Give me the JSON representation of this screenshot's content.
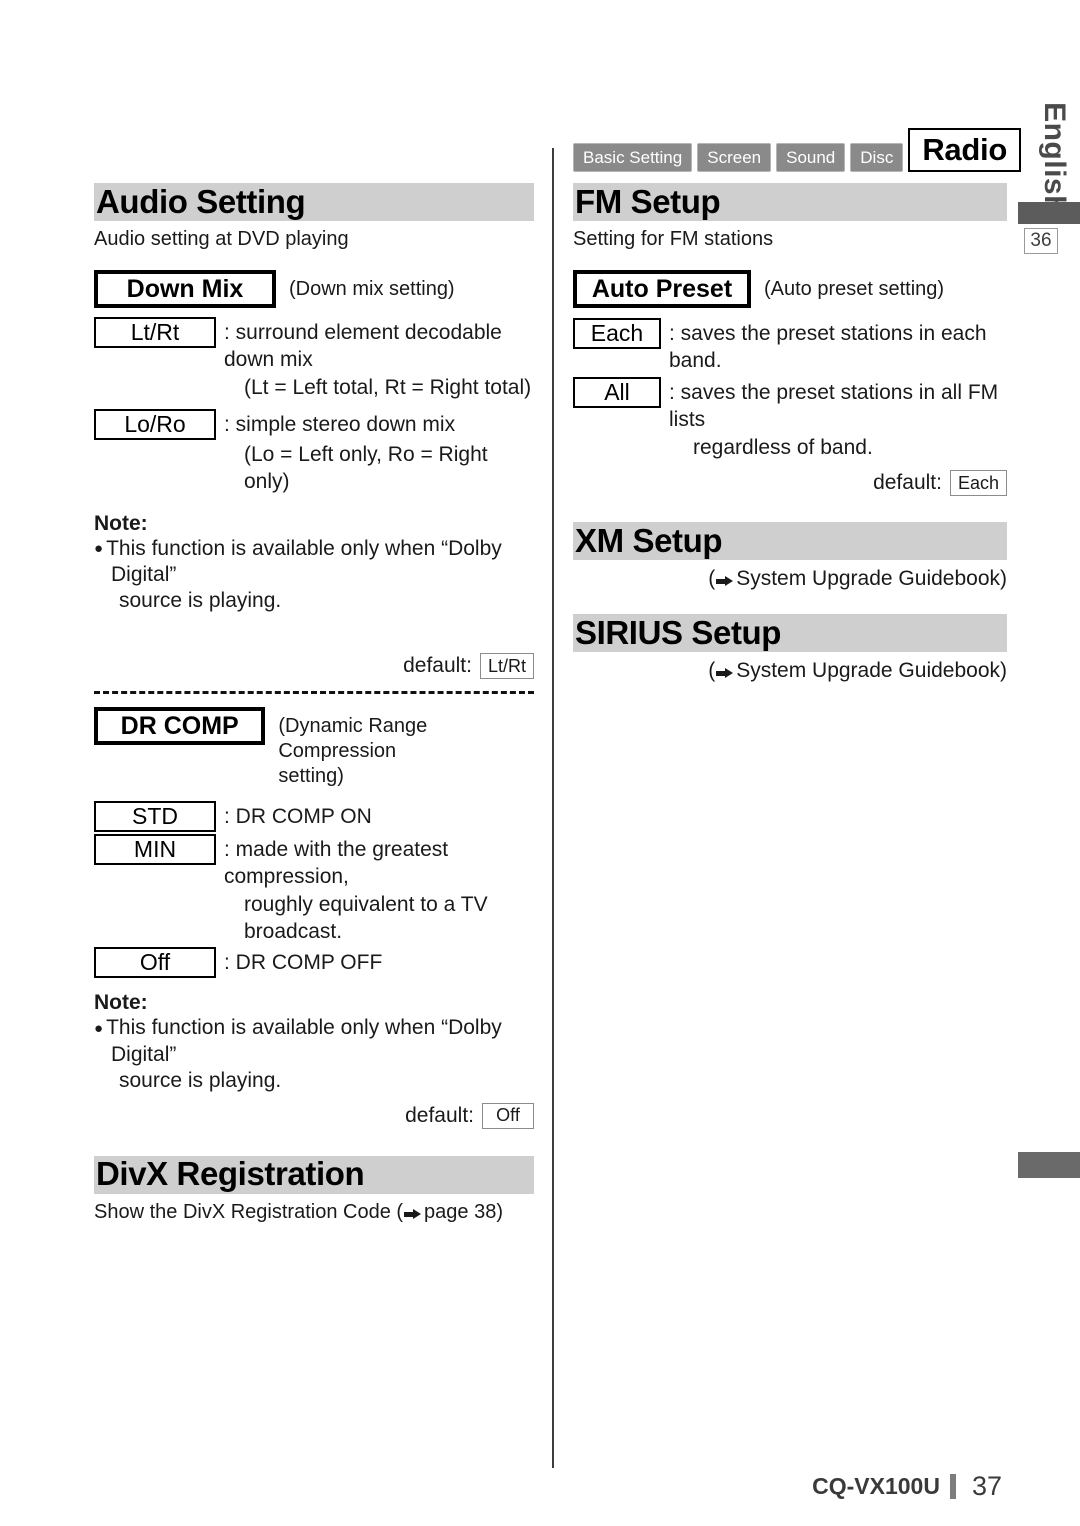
{
  "margin": {
    "language_label": "English",
    "chapter_ref": "36"
  },
  "footer": {
    "model": "CQ-VX100U",
    "page_number": "37"
  },
  "left_column": {
    "audio_setting": {
      "title": "Audio Setting",
      "subtitle": "Audio setting at DVD playing",
      "down_mix": {
        "name": "Down Mix",
        "note": "(Down mix setting)",
        "options": [
          {
            "value": "Lt/Rt",
            "desc": ": surround element decodable down mix",
            "sub": "(Lt = Left total, Rt = Right total)"
          },
          {
            "value": "Lo/Ro",
            "desc": ": simple stereo down mix",
            "sub": "(Lo = Left only, Ro = Right only)"
          }
        ],
        "note_title": "Note:",
        "note_body_1": "This function is available only when “Dolby Digital”",
        "note_body_2": "source is playing.",
        "default_label": "default:",
        "default_value": "Lt/Rt"
      },
      "dr_comp": {
        "name": "DR COMP",
        "note_line_1": "(Dynamic Range Compression",
        "note_line_2": "setting)",
        "options": [
          {
            "value": "STD",
            "desc": ": DR COMP ON",
            "sub": ""
          },
          {
            "value": "MIN",
            "desc": ": made with the greatest compression,",
            "sub": "roughly equivalent to a TV broadcast."
          },
          {
            "value": "Off",
            "desc": ": DR COMP OFF",
            "sub": ""
          }
        ],
        "note_title": "Note:",
        "note_body_1": "This function is available only when “Dolby Digital”",
        "note_body_2": "source is playing.",
        "default_label": "default:",
        "default_value": "Off"
      }
    },
    "divx_registration": {
      "title": "DivX Registration",
      "line_before": "Show the DivX Registration Code (",
      "arrow_icon": "right-arrow-icon",
      "line_after": "page 38)"
    }
  },
  "right_column": {
    "tabs": [
      {
        "label": "Basic Setting",
        "active": false
      },
      {
        "label": "Screen",
        "active": false
      },
      {
        "label": "Sound",
        "active": false
      },
      {
        "label": "Disc",
        "active": false
      },
      {
        "label": "Radio",
        "active": true
      }
    ],
    "fm_setup": {
      "title": "FM Setup",
      "subtitle": "Setting for FM stations",
      "auto_preset": {
        "name": "Auto Preset",
        "note": "(Auto preset setting)",
        "options": [
          {
            "value": "Each",
            "desc": ": saves the preset stations in each band.",
            "sub": ""
          },
          {
            "value": "All",
            "desc": ": saves the preset stations in all FM lists",
            "sub": "regardless of band."
          }
        ],
        "default_label": "default:",
        "default_value": "Each"
      }
    },
    "xm_setup": {
      "title": "XM Setup",
      "ref_before": "(",
      "ref_after": "System Upgrade Guidebook)"
    },
    "sirius_setup": {
      "title": "SIRIUS Setup",
      "ref_before": "(",
      "ref_after": "System Upgrade Guidebook)"
    }
  },
  "colors": {
    "header_bar": "#cfcfcf",
    "tab_inactive": "#8a8a8a",
    "edge_marker": "#5c5c5c",
    "divider": "#3d3d3d"
  }
}
